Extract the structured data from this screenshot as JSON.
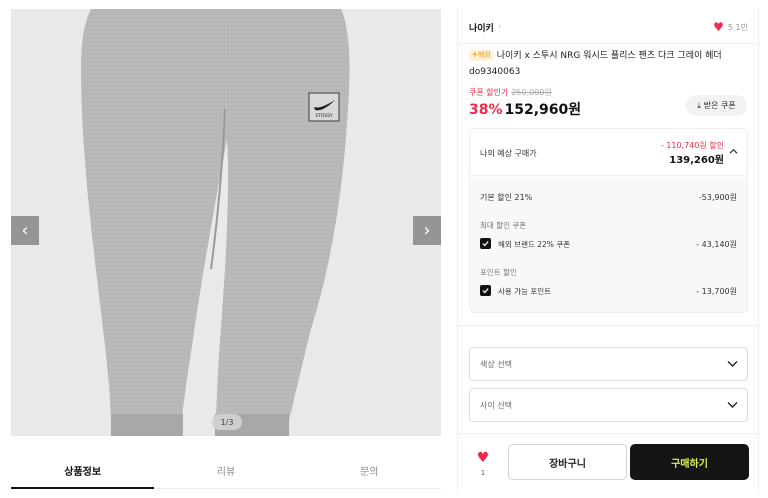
{
  "gallery": {
    "counter": "1/3",
    "prev_icon": "chevron-left-icon",
    "next_icon": "chevron-right-icon",
    "logo_text": "STÜSSY"
  },
  "tabs": [
    {
      "label": "상품정보",
      "active": true
    },
    {
      "label": "리뷰",
      "active": false
    },
    {
      "label": "문의",
      "active": false
    }
  ],
  "product": {
    "brand": "나이키",
    "like_count_top": "5.1만",
    "badge": "해외",
    "title": "나이키 x 스투시 NRG 워시드 플리스 팬츠 다크 그레이 헤더 do9340063",
    "coupon_label": "쿠폰 할인가",
    "original_price": "250,000원",
    "discount_rate": "38%",
    "price": "152,960원",
    "coupon_button": "받은 쿠폰"
  },
  "estimate": {
    "label": "나의 예상 구매가",
    "discount": "- 110,740원 할인",
    "price": "139,260원",
    "rows": {
      "base_label": "기본 할인 21%",
      "base_value": "-53,900원",
      "max_coupon_label": "최대 할인 쿠폰",
      "coupon_item": "해외 브랜드 22% 쿠폰",
      "coupon_value": "- 43,140원",
      "point_label": "포인트 할인",
      "point_item": "사용 가능 포인트",
      "point_value": "- 13,700원"
    }
  },
  "options": {
    "color_select": "색상 선택",
    "size_select": "사이 선택"
  },
  "actions": {
    "like_count": "1",
    "cart": "장바구니",
    "buy": "구매하기"
  },
  "colors": {
    "accent": "#ef2b49",
    "buy_bg": "#151515",
    "buy_text": "#d8f35a"
  }
}
